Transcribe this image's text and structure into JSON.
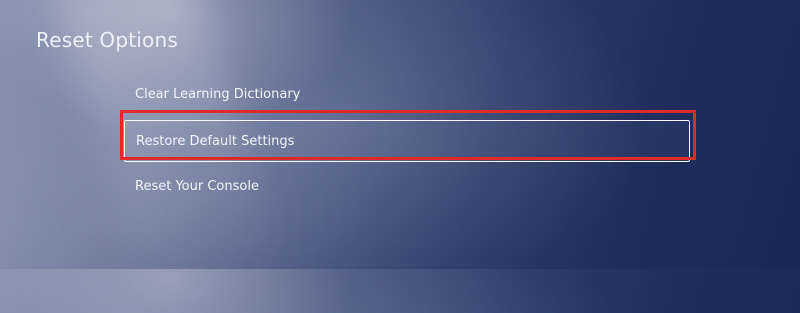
{
  "header": {
    "title": "Reset Options"
  },
  "menu": {
    "items": [
      {
        "label": "Clear Learning Dictionary",
        "selected": false
      },
      {
        "label": "Restore Default Settings",
        "selected": true
      },
      {
        "label": "Reset Your Console",
        "selected": false
      }
    ]
  },
  "colors": {
    "highlight": "#e02a2a",
    "focus_border": "#f5f7fb"
  }
}
